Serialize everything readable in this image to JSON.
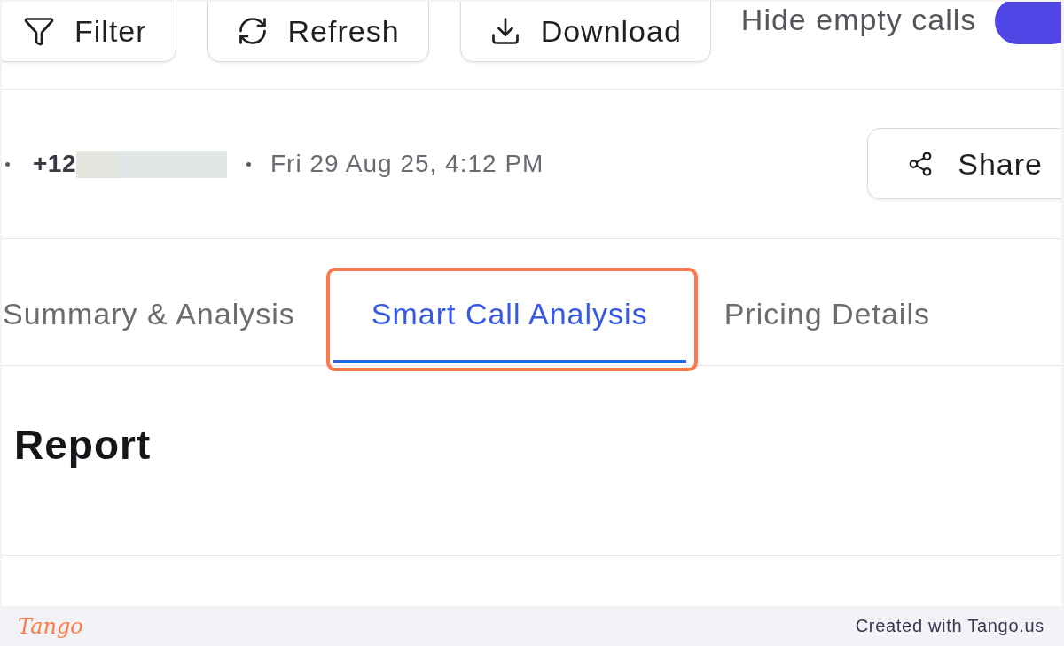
{
  "toolbar": {
    "buttons": [
      {
        "kind": "filter",
        "label": "Filter"
      },
      {
        "kind": "refresh",
        "label": "Refresh"
      },
      {
        "kind": "download",
        "label": "Download"
      }
    ],
    "hide_empty_calls": {
      "label": "Hide empty calls",
      "on": true
    }
  },
  "call_info": {
    "phone_prefix": "+12",
    "phone_redacted": true,
    "datetime": "Fri 29 Aug 25, 4:12 PM",
    "share_button": {
      "label": "Share"
    }
  },
  "tabs": [
    {
      "label": "Summary & Analysis",
      "selected": false,
      "highlighted": false
    },
    {
      "label": "Smart Call Analysis",
      "selected": true,
      "highlighted": true
    },
    {
      "label": "Pricing Details",
      "selected": false,
      "highlighted": false
    }
  ],
  "report": {
    "title": "Report"
  },
  "footer": {
    "logo": "Tango",
    "credit": "Created with Tango.us"
  }
}
